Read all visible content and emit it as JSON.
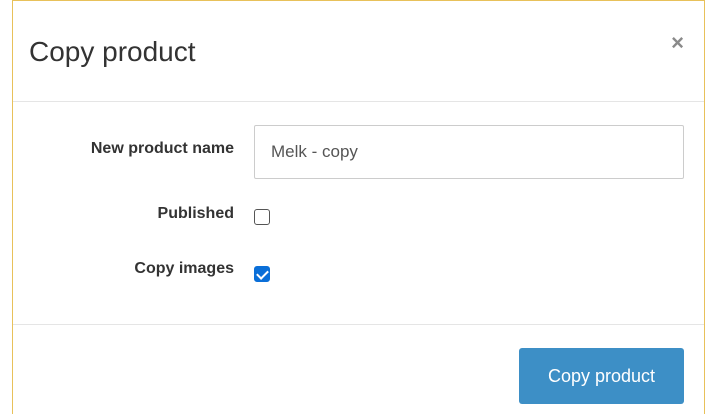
{
  "modal": {
    "title": "Copy product",
    "close_symbol": "×"
  },
  "form": {
    "name_label": "New product name",
    "name_value": "Melk - copy",
    "published_label": "Published",
    "published_checked": false,
    "copy_images_label": "Copy images",
    "copy_images_checked": true
  },
  "footer": {
    "submit_label": "Copy product"
  },
  "colors": {
    "primary_button": "#3d8fc6",
    "checkbox_checked": "#0b6fd8",
    "modal_border": "#e8c15a"
  }
}
